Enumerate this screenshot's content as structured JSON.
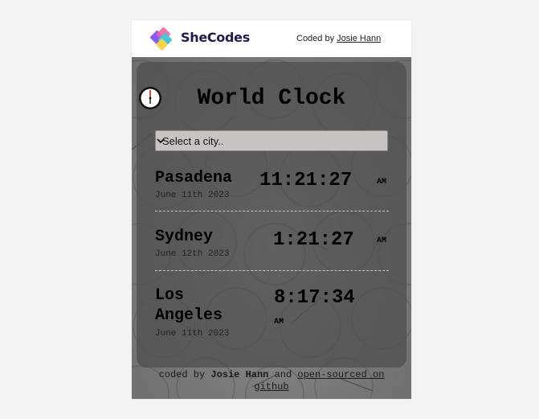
{
  "header": {
    "brand": "SheCodes",
    "coded_by_prefix": "Coded by",
    "coded_by_name": "Josie Hann"
  },
  "app": {
    "title": "World Clock",
    "title_icon": "clock-icon",
    "select_placeholder": "Select a city..",
    "cities": [
      {
        "name": "Pasadena",
        "date": "June 11th 2023",
        "time": "11:21:27",
        "ampm": "AM"
      },
      {
        "name": "Sydney",
        "date": "June 12th 2023",
        "time": "1:21:27",
        "ampm": "AM"
      },
      {
        "name_line1": "Los",
        "name_line2": "Angeles",
        "date": "June 11th 2023",
        "time": "8:17:34",
        "ampm": "AM"
      }
    ]
  },
  "footer": {
    "prefix": "coded by",
    "author": "Josie Hann",
    "middle": "and",
    "link_line1": "open-sourced on",
    "link_line2": "github"
  },
  "colors": {
    "page_background": "#f3f3f3",
    "brand_text": "#1f1b4e",
    "card_overlay": "#505050",
    "select_background": "#c8c4c4"
  }
}
